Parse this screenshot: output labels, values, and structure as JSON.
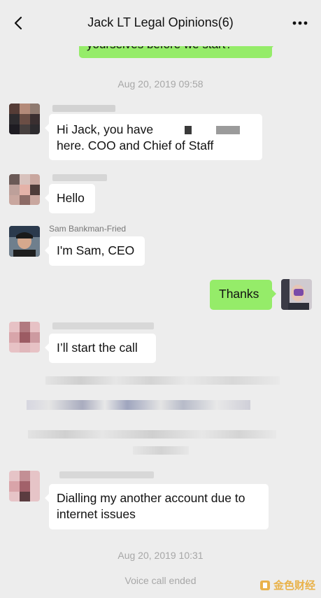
{
  "header": {
    "title": "Jack LT Legal Opinions(6)"
  },
  "messages": {
    "top_partial": "yourselves before we start?",
    "time1": "Aug 20, 2019 09:58",
    "m1": "Hi Jack, you have",
    "m1_line2": "here. COO and Chief of Staff",
    "m2": "Hello",
    "sam_name": "Sam Bankman-Fried",
    "m3": "I'm Sam, CEO",
    "m4": "Thanks",
    "m5": "I’ll start the call",
    "m6": "Dialling my another account due to internet issues",
    "time2": "Aug 20, 2019 10:31",
    "voice": "Voice call ended"
  },
  "colors": {
    "background": "#ededed",
    "sent_bubble": "#95ec69",
    "received_bubble": "#ffffff"
  },
  "watermark": "金色财经"
}
